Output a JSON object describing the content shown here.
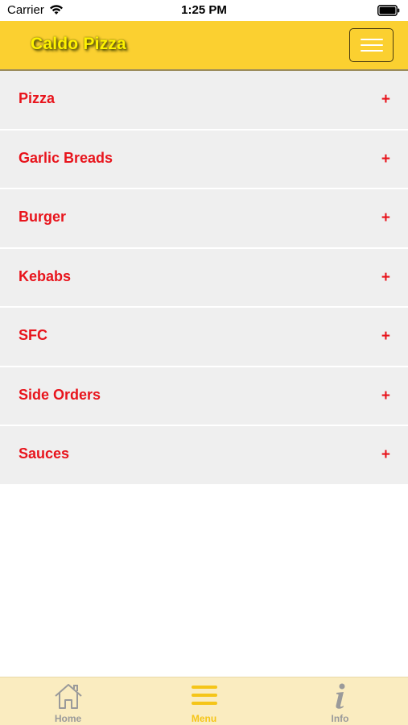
{
  "status_bar": {
    "carrier": "Carrier",
    "time": "1:25 PM"
  },
  "header": {
    "title": "Caldo Pizza",
    "menu_button_icon": "hamburger-icon",
    "background_color": "#fbd030",
    "title_color": "#fff200"
  },
  "menu": {
    "items": [
      {
        "label": "Pizza",
        "expand": "+"
      },
      {
        "label": "Garlic Breads",
        "expand": "+"
      },
      {
        "label": "Burger",
        "expand": "+"
      },
      {
        "label": "Kebabs",
        "expand": "+"
      },
      {
        "label": "SFC",
        "expand": "+"
      },
      {
        "label": "Side Orders",
        "expand": "+"
      },
      {
        "label": "Sauces",
        "expand": "+"
      }
    ],
    "text_color": "#e8141c",
    "row_color": "#efefef"
  },
  "tab_bar": {
    "tabs": [
      {
        "label": "Home",
        "icon": "home-icon",
        "active": false
      },
      {
        "label": "Menu",
        "icon": "menu-lines-icon",
        "active": true
      },
      {
        "label": "Info",
        "icon": "info-icon",
        "active": false
      }
    ],
    "active_color": "#f5c518",
    "inactive_color": "#9a9a9a",
    "background_color": "#faecc0"
  }
}
